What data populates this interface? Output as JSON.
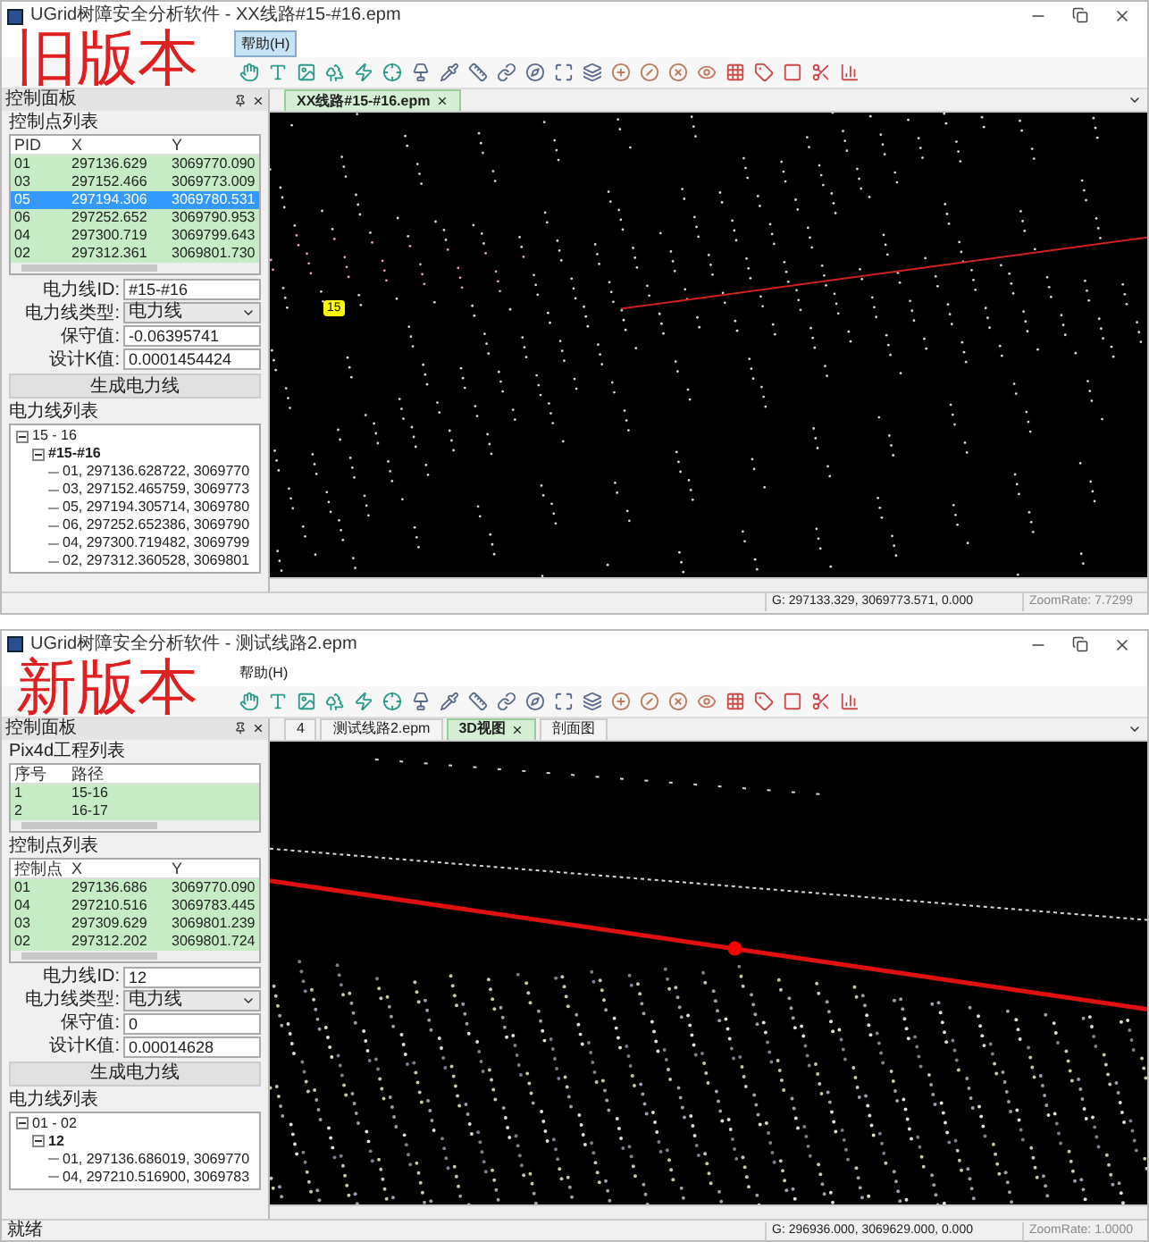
{
  "windows": [
    {
      "title": "UGrid树障安全分析软件 - XX线路#15-#16.epm",
      "annotation": "旧版本",
      "menu": [
        {
          "label": "帮助(H)",
          "selected": true
        }
      ],
      "panel_title": "控制面板",
      "sections": [
        {
          "kind": "table",
          "title": "控制点列表",
          "columns": [
            "PID",
            "X",
            "Y"
          ],
          "rows": [
            {
              "cells": [
                "01",
                "297136.629",
                "3069770.090"
              ],
              "selected": false
            },
            {
              "cells": [
                "03",
                "297152.466",
                "3069773.009"
              ],
              "selected": false
            },
            {
              "cells": [
                "05",
                "297194.306",
                "3069780.531"
              ],
              "selected": true
            },
            {
              "cells": [
                "06",
                "297252.652",
                "3069790.953"
              ],
              "selected": false
            },
            {
              "cells": [
                "04",
                "297300.719",
                "3069799.643"
              ],
              "selected": false
            },
            {
              "cells": [
                "02",
                "297312.361",
                "3069801.730"
              ],
              "selected": false
            }
          ]
        },
        {
          "kind": "form",
          "fields": [
            {
              "label": "电力线ID:",
              "value": "#15-#16",
              "kind": "input"
            },
            {
              "label": "电力线类型:",
              "value": "电力线",
              "kind": "select"
            },
            {
              "label": "保守值:",
              "value": "-0.06395741",
              "kind": "input"
            },
            {
              "label": "设计K值:",
              "value": "0.0001454424",
              "kind": "input"
            }
          ],
          "button": "生成电力线"
        },
        {
          "kind": "tree",
          "title": "电力线列表",
          "nodes": [
            {
              "label": "15 - 16",
              "expanded": true,
              "children": [
                {
                  "label": "#15-#16",
                  "expanded": true,
                  "children": [
                    {
                      "label": "01, 297136.628722, 3069770"
                    },
                    {
                      "label": "03, 297152.465759, 3069773"
                    },
                    {
                      "label": "05, 297194.305714, 3069780"
                    },
                    {
                      "label": "06, 297252.652386, 3069790"
                    },
                    {
                      "label": "04, 297300.719482, 3069799"
                    },
                    {
                      "label": "02, 297312.360528, 3069801"
                    }
                  ]
                }
              ]
            }
          ]
        }
      ],
      "tabs": [
        {
          "label": "XX线路#15-#16.epm",
          "selected": true,
          "closable": true
        }
      ],
      "markers": [
        {
          "label": "15"
        }
      ],
      "status": {
        "coords": "G: 297133.329, 3069773.571, 0.000",
        "zoom": "ZoomRate: 7.7299"
      }
    },
    {
      "title": "UGrid树障安全分析软件 - 测试线路2.epm",
      "annotation": "新版本",
      "menu": [
        {
          "label": "帮助(H)",
          "selected": false
        }
      ],
      "panel_title": "控制面板",
      "sections": [
        {
          "kind": "table",
          "title": "Pix4d工程列表",
          "columns": [
            "序号",
            "路径"
          ],
          "rows": [
            {
              "cells": [
                "1",
                "15-16"
              ],
              "selected": false
            },
            {
              "cells": [
                "2",
                "16-17"
              ],
              "selected": false
            }
          ]
        },
        {
          "kind": "table",
          "title": "控制点列表",
          "columns": [
            "控制点",
            "X",
            "Y"
          ],
          "rows": [
            {
              "cells": [
                "01",
                "297136.686",
                "3069770.090"
              ],
              "selected": false
            },
            {
              "cells": [
                "04",
                "297210.516",
                "3069783.445"
              ],
              "selected": false
            },
            {
              "cells": [
                "03",
                "297309.629",
                "3069801.239"
              ],
              "selected": false
            },
            {
              "cells": [
                "02",
                "297312.202",
                "3069801.724"
              ],
              "selected": false
            }
          ]
        },
        {
          "kind": "form",
          "fields": [
            {
              "label": "电力线ID:",
              "value": "12",
              "kind": "input"
            },
            {
              "label": "电力线类型:",
              "value": "电力线",
              "kind": "select"
            },
            {
              "label": "保守值:",
              "value": "0",
              "kind": "input"
            },
            {
              "label": "设计K值:",
              "value": "0.00014628",
              "kind": "input"
            }
          ],
          "button": "生成电力线"
        },
        {
          "kind": "tree",
          "title": "电力线列表",
          "nodes": [
            {
              "label": "01 - 02",
              "expanded": true,
              "children": [
                {
                  "label": "12",
                  "expanded": true,
                  "children": [
                    {
                      "label": "01, 297136.686019, 3069770"
                    },
                    {
                      "label": "04, 297210.516900, 3069783"
                    }
                  ]
                }
              ]
            }
          ]
        }
      ],
      "tabs": [
        {
          "label": "4",
          "selected": false,
          "closable": false
        },
        {
          "label": "测试线路2.epm",
          "selected": false,
          "closable": false
        },
        {
          "label": "3D视图",
          "selected": true,
          "closable": true
        },
        {
          "label": "剖面图",
          "selected": false,
          "closable": false
        }
      ],
      "status": {
        "message": "就绪",
        "coords": "G: 296936.000, 3069629.000, 0.000",
        "zoom": "ZoomRate: 1.0000"
      }
    }
  ]
}
